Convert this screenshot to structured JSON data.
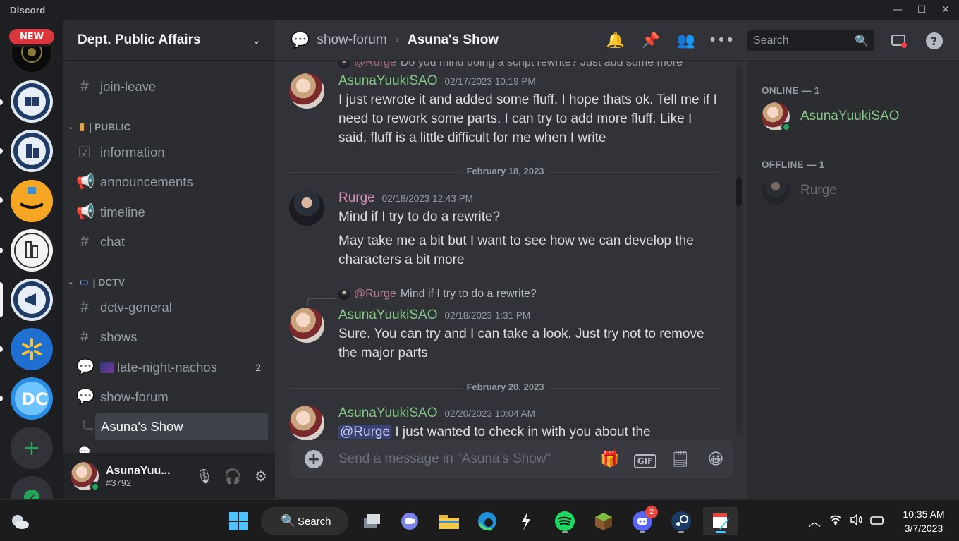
{
  "app": {
    "title": "Discord",
    "new_badge": "NEW"
  },
  "window_controls": {
    "minimize": "—",
    "maximize": "☐",
    "close": "✕"
  },
  "server": {
    "name": "Dept. Public Affairs",
    "channels": [
      {
        "name": "join-leave"
      }
    ],
    "categories": [
      {
        "label": "| PUBLIC",
        "channels": [
          "information",
          "announcements",
          "timeline",
          "chat"
        ]
      },
      {
        "label": "| DCTV",
        "channels": [
          "dctv-general",
          "shows",
          "late-night-nachos",
          "show-forum"
        ]
      }
    ],
    "late_night_count": "2",
    "active_thread": "Asuna's Show",
    "partial_channel": "..."
  },
  "user": {
    "name": "AsunaYuu...",
    "tag": "#3792"
  },
  "header": {
    "parent": "show-forum",
    "separator": "›",
    "current": "Asuna's Show",
    "search_placeholder": "Search"
  },
  "messages": {
    "top_reply": {
      "mention": "@Rurge",
      "text": "Do you mind doing a script rewrite? Just add some more"
    },
    "m1": {
      "author": "AsunaYuukiSAO",
      "time": "02/17/2023 10:19 PM",
      "text": "I just rewrote it and added some fluff. I hope thats ok. Tell me if I need to rework some parts. I can try to add more fluff. Like I said, fluff is a little difficult for me when I write"
    },
    "divider1": "February 18, 2023",
    "m2": {
      "author": "Rurge",
      "time": "02/18/2023 12:43 PM",
      "text": "Mind if I try to do a rewrite?",
      "text2": "May take me a bit but I want to see how we can develop the characters a bit more"
    },
    "reply3": {
      "mention": "@Rurge",
      "text": "Mind if I try to do a rewrite?"
    },
    "m3": {
      "author": "AsunaYuukiSAO",
      "time": "02/18/2023 1:31 PM",
      "text": "Sure. You can try and I can take a look. Just try not to remove the major parts"
    },
    "divider2": "February 20, 2023",
    "m4": {
      "author": "AsunaYuukiSAO",
      "time": "02/20/2023 10:04 AM",
      "mention": "@Rurge",
      "text": "I just wanted to check in with you about the"
    }
  },
  "composer": {
    "placeholder": "Send a message in \"Asuna's Show\"",
    "gif": "GIF"
  },
  "members": {
    "online_label": "ONLINE — 1",
    "online": [
      "AsunaYuukiSAO"
    ],
    "offline_label": "OFFLINE — 1",
    "offline": [
      "Rurge"
    ]
  },
  "taskbar": {
    "search": "Search",
    "discord_badge": "2",
    "time": "10:35 AM",
    "date": "3/7/2023"
  },
  "colors": {
    "online_name": "#83c784",
    "rurge": "#d68fb5",
    "offline_name": "#6d6f78"
  }
}
